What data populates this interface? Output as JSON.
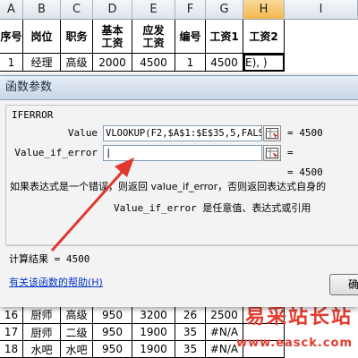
{
  "columns": [
    "A",
    "B",
    "C",
    "D",
    "E",
    "F",
    "G",
    "H",
    "I"
  ],
  "selected_column": "H",
  "headers": [
    "序号",
    "岗位",
    "职务",
    "基本工资",
    "应发工资",
    "编号",
    "工资1",
    "工资2"
  ],
  "row1": [
    "1",
    "经理",
    "高级",
    "2000",
    "4500",
    "1",
    "4500",
    "E), )"
  ],
  "bottom_rows": [
    [
      "16",
      "厨师",
      "高级",
      "950",
      "3200",
      "26",
      "2500",
      ""
    ],
    [
      "17",
      "厨师",
      "二级",
      "950",
      "1900",
      "35",
      "#N/A",
      ""
    ],
    [
      "18",
      "水吧",
      "水吧",
      "950",
      "1900",
      "35",
      "#N/A",
      ""
    ]
  ],
  "dialog": {
    "title": "函数参数",
    "function_name": "IFERROR",
    "arg1_label": "Value",
    "arg1_value": "VLOOKUP(F2,$A$1:$E$35,5,FALS",
    "arg1_result": "= 4500",
    "arg2_label": "Value_if_error",
    "arg2_value": "|",
    "arg2_result": "=",
    "formula_result": "= 4500",
    "description": "如果表达式是一个错误，则返回 value_if_error，否则返回表达式自身的",
    "arg_description": "Value_if_error  是任意值、表达式或引用",
    "calc_result": "计算结果 =  4500",
    "help_link": "有关该函数的帮助(H)",
    "ok_label": "确"
  },
  "watermark": {
    "text": "易采站长站",
    "url": "www.easck.com"
  },
  "colors": {
    "arrow": "#e0382c",
    "na_text": "#0a8a2a",
    "selected_col": "#f1b94d"
  }
}
